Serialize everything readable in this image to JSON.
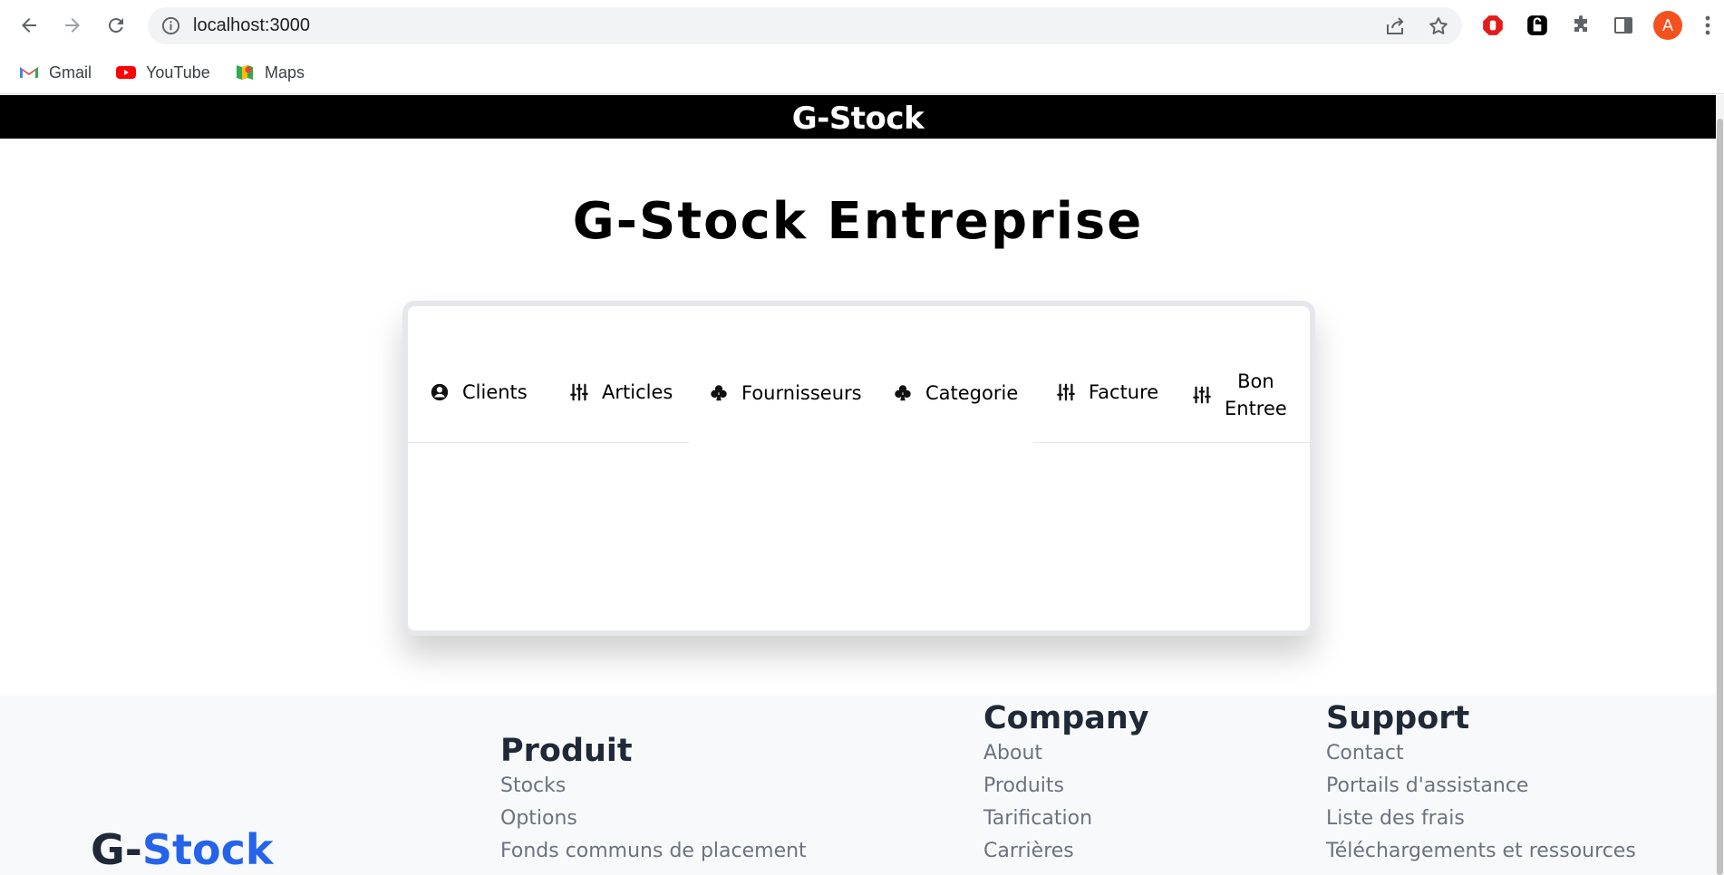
{
  "browser": {
    "url": "localhost:3000",
    "avatar_letter": "A",
    "bookmarks": [
      {
        "label": "Gmail",
        "icon": "gmail-icon"
      },
      {
        "label": "YouTube",
        "icon": "youtube-icon"
      },
      {
        "label": "Maps",
        "icon": "maps-icon"
      }
    ]
  },
  "app": {
    "header_title": "G-Stock",
    "page_heading": "G-Stock Entreprise",
    "tabs": [
      {
        "label": "Clients",
        "icon": "user-circle-icon"
      },
      {
        "label": "Articles",
        "icon": "sliders-icon"
      },
      {
        "label": "Fournisseurs",
        "icon": "club-icon"
      },
      {
        "label": "Categorie",
        "icon": "club-icon"
      },
      {
        "label": "Facture",
        "icon": "sliders-icon"
      },
      {
        "label_line1": "Bon",
        "label_line2": "Entree",
        "icon": "sliders-icon"
      }
    ]
  },
  "footer": {
    "brand_prefix": "G-",
    "brand_accent": "Stock",
    "produit": {
      "title": "Produit",
      "links": [
        "Stocks",
        "Options",
        "Fonds communs de placement"
      ]
    },
    "company": {
      "title": "Company",
      "links": [
        "About",
        "Produits",
        "Tarification",
        "Carrières"
      ]
    },
    "support": {
      "title": "Support",
      "links": [
        "Contact",
        "Portails d'assistance",
        "Liste des frais",
        "Téléchargements et ressources"
      ]
    }
  },
  "colors": {
    "header_bg": "#000000",
    "brand_accent": "#2563eb",
    "footer_bg": "#f8f9fa",
    "footer_link": "#6b7280"
  }
}
